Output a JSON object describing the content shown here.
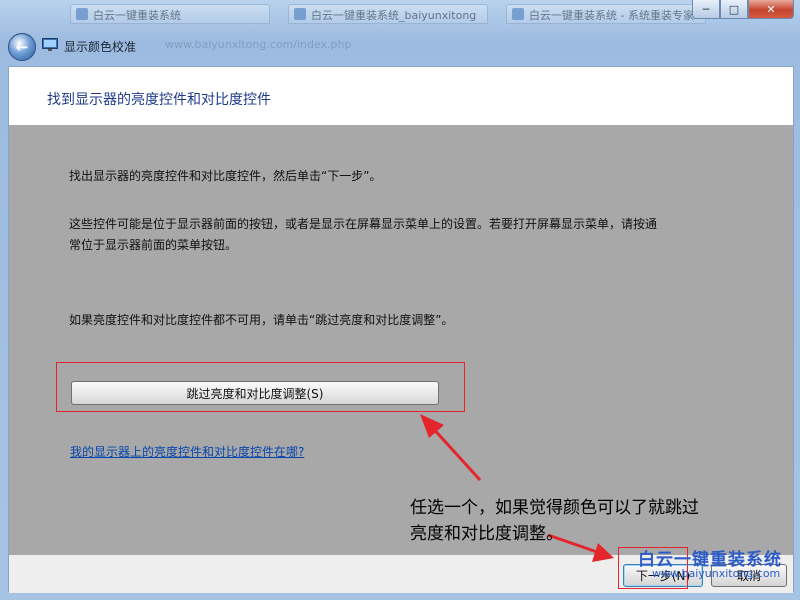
{
  "browser": {
    "tabs": [
      "白云一键重装系统",
      "白云一键重装系统_baiyunxitong",
      "白云一键重装系统 - 系统重装专家"
    ]
  },
  "window": {
    "title": "显示颜色校准",
    "background_url": "www.baiyunxitong.com/index.php",
    "minimize": "─",
    "maximize": "□",
    "close": "✕"
  },
  "page": {
    "heading": "找到显示器的亮度控件和对比度控件",
    "paragraph1": "找出显示器的亮度控件和对比度控件，然后单击“下一步”。",
    "paragraph2_line1": "这些控件可能是位于显示器前面的按钮，或者是显示在屏幕显示菜单上的设置。若要打开屏幕显示菜单，请按通",
    "paragraph2_line2": "常位于显示器前面的菜单按钮。",
    "paragraph3": "如果亮度控件和对比度控件都不可用，请单击“跳过亮度和对比度调整”。",
    "skip_button": "跳过亮度和对比度调整(S)",
    "help_link": "我的显示器上的亮度控件和对比度控件在哪?"
  },
  "footer": {
    "next_button": "下一步(N)",
    "cancel_button": "取消"
  },
  "annotation": {
    "line1": "任选一个，如果觉得颜色可以了就跳过",
    "line2": "亮度和对比度调整。"
  },
  "watermark": {
    "text": "白云一键重装系统",
    "url": "www.baiyunxitong.com"
  },
  "colors": {
    "annotation_red": "#e4252c",
    "heading_blue": "#1e3a8a",
    "link_blue": "#0645ad"
  }
}
